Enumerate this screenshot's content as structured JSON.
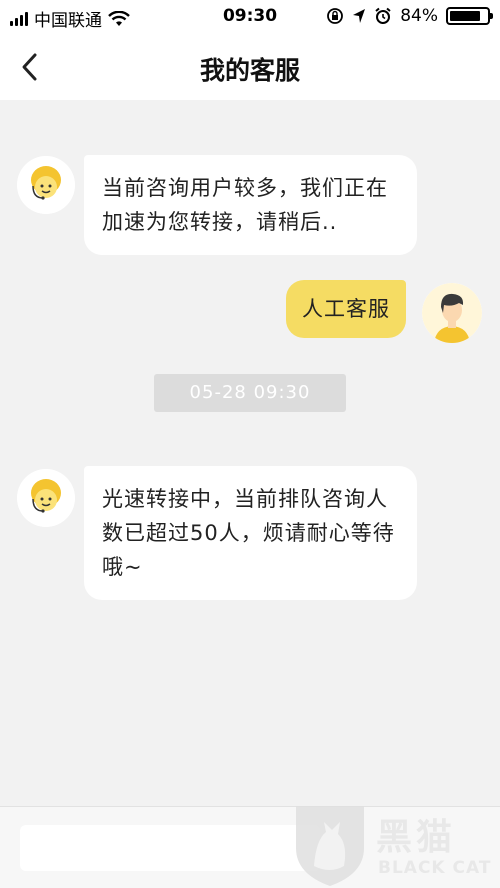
{
  "status_bar": {
    "carrier": "中国联通",
    "time": "09:30",
    "battery_percent": "84%",
    "battery_level": 0.84,
    "icons": [
      "signal-icon",
      "wifi-icon",
      "rotation-lock-icon",
      "location-icon",
      "alarm-icon",
      "battery-icon"
    ]
  },
  "header": {
    "title": "我的客服",
    "back_icon": "chevron-left-icon"
  },
  "messages": [
    {
      "sender": "agent",
      "text": "当前咨询用户较多，我们正在加速为您转接，请稍后.."
    },
    {
      "sender": "user",
      "text": "人工客服"
    },
    {
      "type": "timestamp",
      "text": "05-28 09:30"
    },
    {
      "sender": "agent",
      "text": "光速转接中，当前排队咨询人数已超过50人，烦请耐心等待哦~"
    }
  ],
  "input": {
    "value": "",
    "placeholder": ""
  },
  "watermark": {
    "cn": "黑猫",
    "en": "BLACK CAT"
  },
  "colors": {
    "user_bubble": "#f5dc63",
    "agent_avatar_hair": "#f4c430",
    "background": "#f2f2f2"
  }
}
